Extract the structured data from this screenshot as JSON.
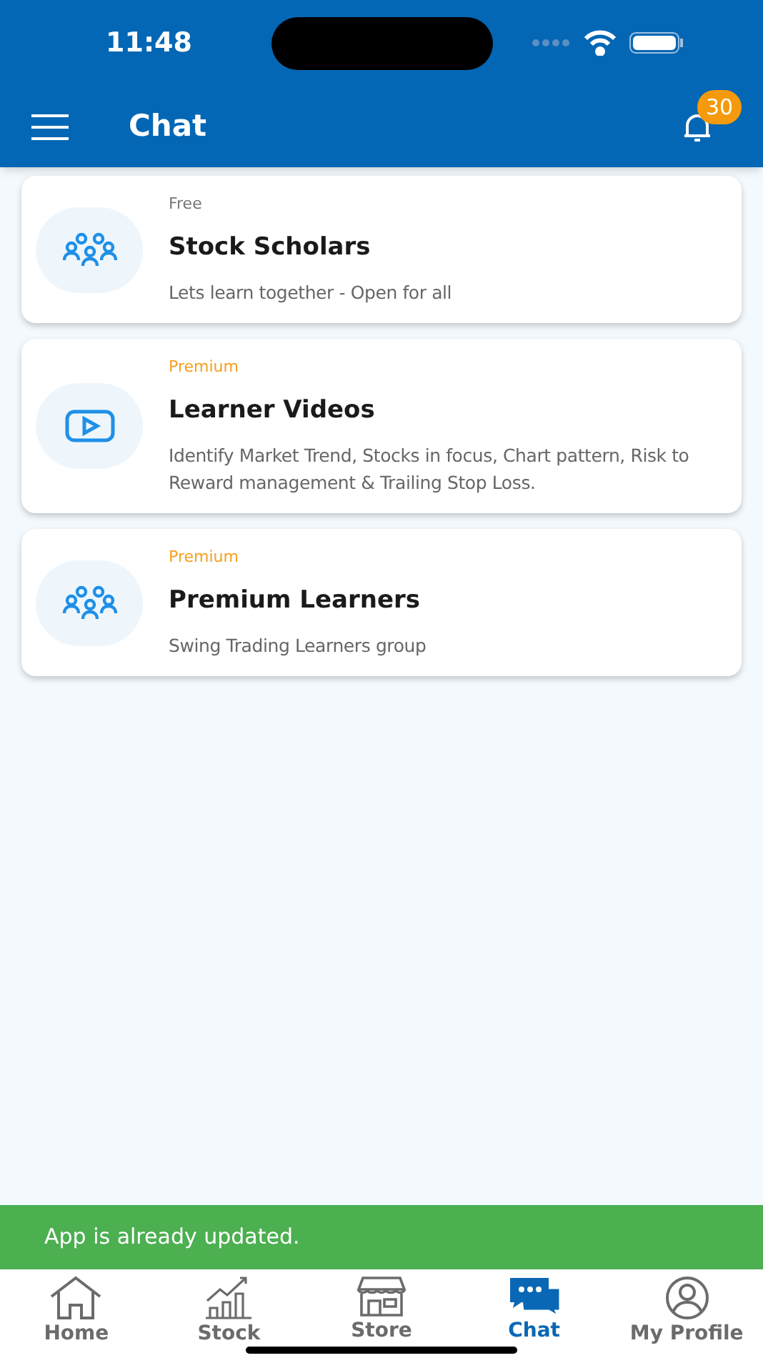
{
  "status_bar": {
    "time": "11:48"
  },
  "header": {
    "title": "Chat",
    "notification_count": "30"
  },
  "chats": [
    {
      "tier": "Free",
      "kind": "free",
      "title": "Stock Scholars",
      "description": "Lets learn together - Open for all"
    },
    {
      "tier": "Premium",
      "kind": "premium",
      "title": "Learner Videos",
      "description": "Identify Market Trend, Stocks in focus, Chart pattern, Risk to Reward management & Trailing Stop Loss."
    },
    {
      "tier": "Premium",
      "kind": "premium",
      "title": "Premium Learners",
      "description": "Swing Trading Learners group"
    }
  ],
  "toast": "App is already updated.",
  "tabs": [
    {
      "label": "Home",
      "selected": false
    },
    {
      "label": "Stock",
      "selected": false
    },
    {
      "label": "Store",
      "selected": false
    },
    {
      "label": "Chat",
      "selected": true
    },
    {
      "label": "My Profile",
      "selected": false
    }
  ]
}
